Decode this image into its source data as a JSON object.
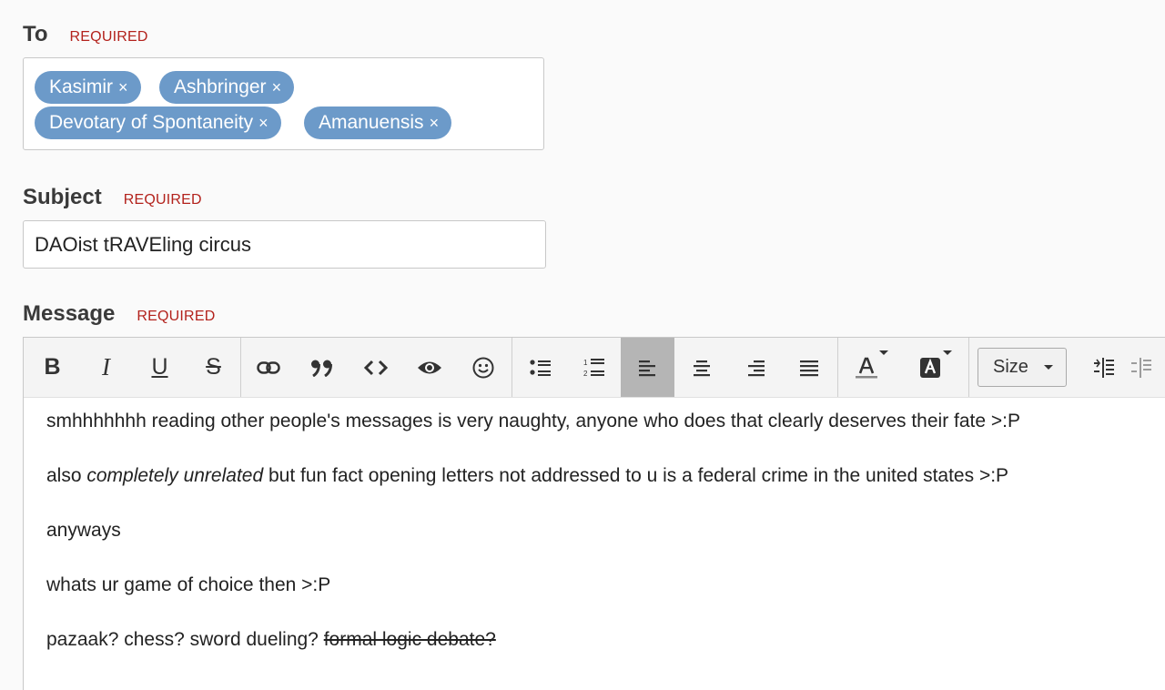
{
  "to": {
    "label": "To",
    "required": "REQUIRED",
    "recipients": [
      "Kasimir",
      "Ashbringer",
      "Devotary of Spontaneity",
      "Amanuensis"
    ],
    "remove_glyph": "×"
  },
  "subject": {
    "label": "Subject",
    "required": "REQUIRED",
    "value": "DAOist tRAVEling circus"
  },
  "message": {
    "label": "Message",
    "required": "REQUIRED",
    "size_label": "Size",
    "lines": [
      {
        "text": "smhhhhhhh reading other people's messages is very naughty, anyone who does that clearly deserves their fate >:P"
      },
      {
        "pre": "also ",
        "em": "completely unrelated",
        "post": " but fun fact opening letters not addressed to u is a federal crime in the united states >:P"
      },
      {
        "text": "anyways"
      },
      {
        "text": "whats ur game of choice then >:P"
      },
      {
        "pre": "pazaak? chess? sword dueling? ",
        "strike": "formal logic debate?"
      }
    ]
  },
  "toolbar": {
    "bold": "B",
    "italic": "I",
    "underline": "U",
    "strike": "S",
    "icons": [
      "link-icon",
      "quote-icon",
      "code-icon",
      "eye-icon",
      "emoji-icon",
      "bullet-list-icon",
      "numbered-list-icon",
      "align-left-icon",
      "align-center-icon",
      "align-right-icon",
      "align-justify-icon",
      "text-color-icon",
      "background-color-icon",
      "indent-icon",
      "outdent-icon"
    ],
    "active_alignment": "left"
  }
}
